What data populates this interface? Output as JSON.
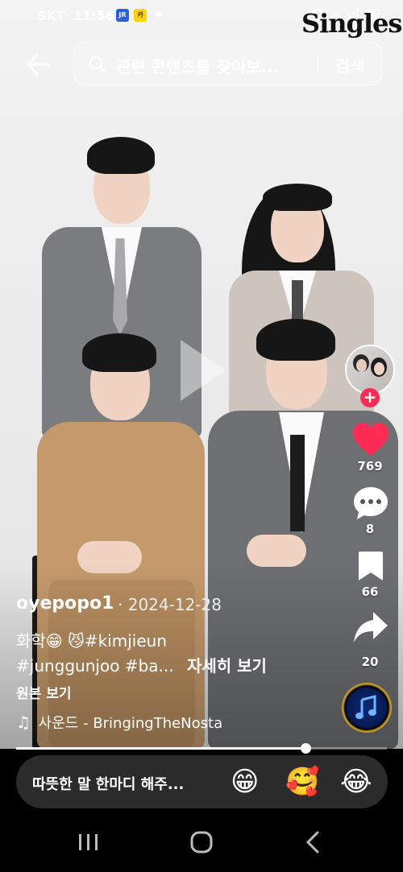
{
  "status_bar": {
    "carrier": "SKT",
    "time": "11:56",
    "badge_1": "JR",
    "badge_2": "카",
    "watermark": "Singles"
  },
  "search": {
    "placeholder": "관련 콘텐츠를 찾아보...",
    "button_label": "검색",
    "back_icon": "arrow-left-icon",
    "search_icon": "magnifier-icon"
  },
  "rail": {
    "likes": "769",
    "comments": "8",
    "saves": "66",
    "shares": "20",
    "follow_symbol": "+",
    "like_color": "#fe2c55"
  },
  "post": {
    "username": "oyepopo1",
    "date": "· 2024-12-28",
    "caption_line1": "화학😁    😼#kimjieun",
    "caption_line2": "#junggunjoo #ba...",
    "see_more": "자세히 보기",
    "original_label": "원본 보기",
    "sound_note": "♫",
    "sound": "사운드 - BringingTheNosta"
  },
  "progress": {
    "fraction": 0.78
  },
  "comment": {
    "placeholder": "따뜻한 말 한마디 해주...",
    "emoji_1": "😁",
    "emoji_2": "🥰",
    "emoji_3": "😂"
  }
}
